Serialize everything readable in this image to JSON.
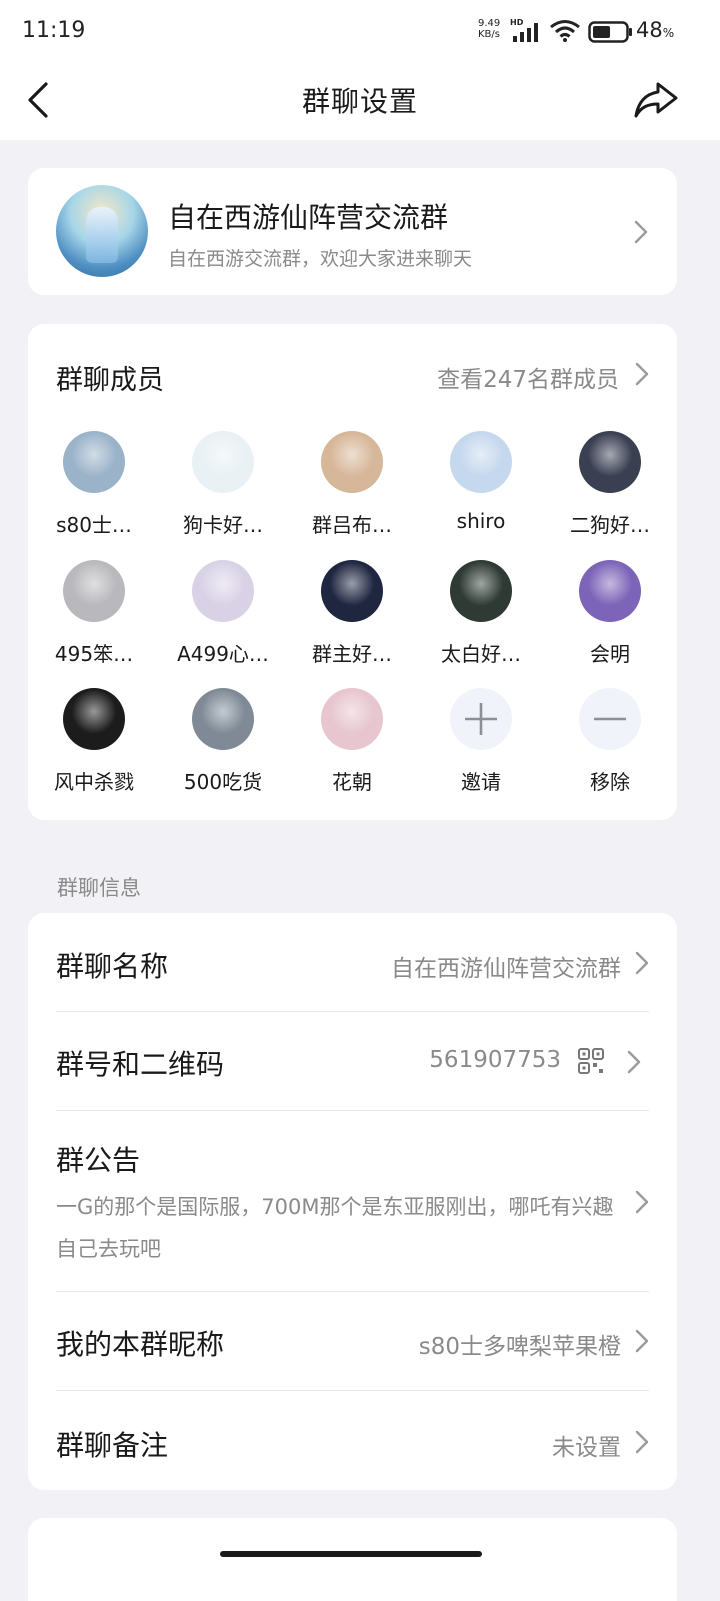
{
  "status_bar": {
    "time": "11:19",
    "net_speed_value": "9.49",
    "net_speed_unit": "KB/s",
    "hd_label": "HD",
    "battery_percent": "48",
    "battery_symbol": "%",
    "icons": [
      "signal-icon",
      "wifi-icon",
      "battery-icon"
    ]
  },
  "nav": {
    "title": "群聊设置",
    "back_icon": "chevron-left-icon",
    "share_icon": "share-icon"
  },
  "group": {
    "name": "自在西游仙阵营交流群",
    "description": "自在西游交流群，欢迎大家进来聊天"
  },
  "members": {
    "title": "群聊成员",
    "view_all": "查看247名群成员",
    "list": [
      {
        "name": "s80士…",
        "color": "#9bb3c9"
      },
      {
        "name": "狗卡好…",
        "color": "#e9f1f4"
      },
      {
        "name": "群吕布…",
        "color": "#d7b79a"
      },
      {
        "name": "shiro",
        "color": "#c6d8ee"
      },
      {
        "name": "二狗好…",
        "color": "#3a3f52"
      },
      {
        "name": "495笨…",
        "color": "#b9b9bd"
      },
      {
        "name": "A499心…",
        "color": "#d9d2e6"
      },
      {
        "name": "群主好…",
        "color": "#1f2640"
      },
      {
        "name": "太白好…",
        "color": "#2e3a33"
      },
      {
        "name": "会明",
        "color": "#7c64b8"
      },
      {
        "name": "风中杀戮",
        "color": "#1c1c1c"
      },
      {
        "name": "500吃货",
        "color": "#7f8a96"
      },
      {
        "name": "花朝",
        "color": "#e7c6cf"
      }
    ],
    "invite_label": "邀请",
    "remove_label": "移除"
  },
  "info_section": {
    "label": "群聊信息",
    "group_name_label": "群聊名称",
    "group_name_value": "自在西游仙阵营交流群",
    "group_id_label": "群号和二维码",
    "group_id_value": "561907753",
    "notice_label": "群公告",
    "notice_text": "一G的那个是国际服，700M那个是东亚服刚出，哪吒有兴趣自己去玩吧",
    "nickname_label": "我的本群昵称",
    "nickname_value": "s80士多啤梨苹果橙",
    "remark_label": "群聊备注",
    "remark_value": "未设置"
  },
  "colors": {
    "background": "#f2f2f6",
    "card": "#ffffff",
    "primary_text": "#1a1a1a",
    "secondary_text": "#8a8a8a"
  }
}
